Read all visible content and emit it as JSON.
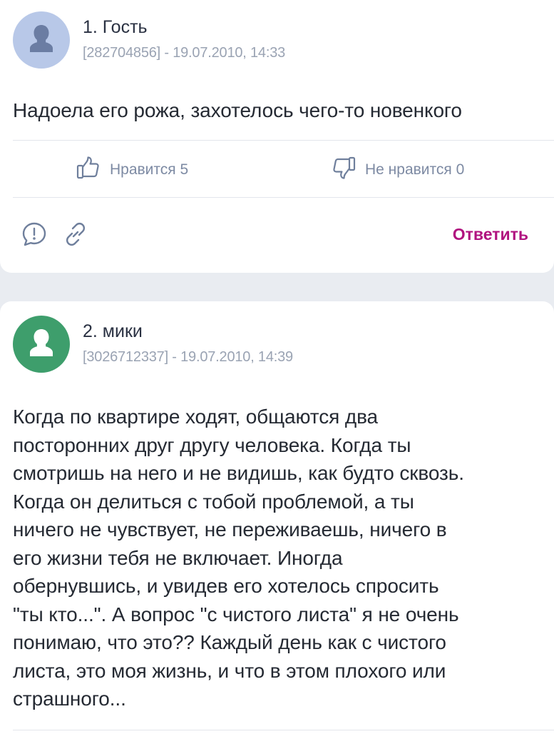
{
  "comments": [
    {
      "author": "1. Гость",
      "meta": "[282704856] - 19.07.2010, 14:33",
      "avatar_color": "#b8c8e8",
      "text": "Надоела его рожа, захотелось чего-то новенкого",
      "like_label": "Нравится 5",
      "dislike_label": "Не нравится 0",
      "reply_label": "Ответить"
    },
    {
      "author": "2. мики",
      "meta": "[3026712337] - 19.07.2010, 14:39",
      "avatar_color": "#3e9e6c",
      "text": "Когда по квартире ходят, общаются два\nпосторонних друг другу человека. Когда ты\nсмотришь на него и не видишь, как будто сквозь.\nКогда он делиться с тобой проблемой, а ты\nничего не чувствует, не переживаешь, ничего в\nего жизни тебя не включает. Иногда\nобернувшись, и увидев его хотелось спросить\n\"ты кто...\". А вопрос \"с чистого листа\" я не очень\nпонимаю, что это?? Каждый день как с чистого\nлиста, это моя жизнь, и что в этом плохого или\nстрашного..."
    }
  ],
  "icons": {
    "avatar": "person-silhouette-icon",
    "like": "thumbs-up-icon",
    "dislike": "thumbs-down-icon",
    "report": "exclamation-bubble-icon",
    "link": "link-icon"
  },
  "colors": {
    "accent": "#b0127f",
    "muted": "#7d8aa3",
    "background": "#e9ecf1"
  }
}
